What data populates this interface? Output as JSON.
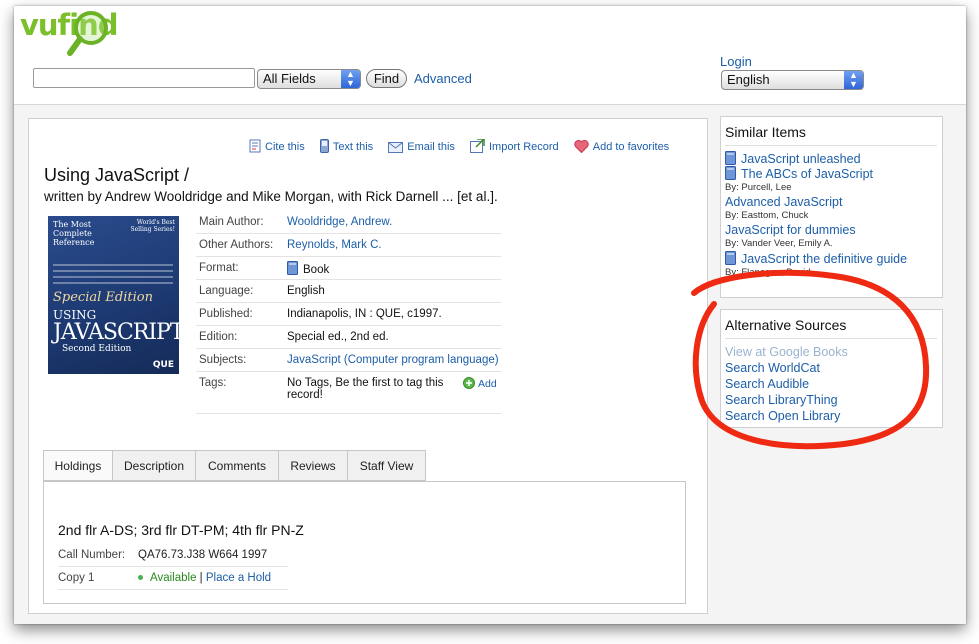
{
  "header": {
    "logo_text": "vufind",
    "search_value": "",
    "field_select": "All Fields",
    "find_label": "Find",
    "advanced_label": "Advanced",
    "login_label": "Login",
    "language_select": "English"
  },
  "toolbar": {
    "cite": "Cite this",
    "text": "Text this",
    "email": "Email this",
    "import": "Import Record",
    "favorite": "Add to favorites"
  },
  "record": {
    "title": "Using JavaScript /",
    "statement": "written by Andrew Wooldridge and Mike Morgan, with Rick Darnell ... [et al.].",
    "cover": {
      "line1": "The Most Complete Reference",
      "line2": "World's Best Selling Series!",
      "edition_script": "Special Edition",
      "using": "USING",
      "javascript": "JAVASCRIPT",
      "second": "Second Edition",
      "publisher": "QUE"
    },
    "fields": [
      {
        "label": "Main Author:",
        "value": "Wooldridge, Andrew.",
        "link": true
      },
      {
        "label": "Other Authors:",
        "value": "Reynolds, Mark C.",
        "link": true
      },
      {
        "label": "Format:",
        "value": "Book",
        "link": false
      },
      {
        "label": "Language:",
        "value": "English",
        "link": false
      },
      {
        "label": "Published:",
        "value": "Indianapolis, IN : QUE, c1997.",
        "link": false
      },
      {
        "label": "Edition:",
        "value": "Special ed., 2nd ed.",
        "link": false
      },
      {
        "label": "Subjects:",
        "value": "JavaScript (Computer program language)",
        "link": true
      },
      {
        "label": "Tags:",
        "value": "No Tags, Be the first to tag this record!",
        "link": false
      }
    ],
    "tags_add": "Add"
  },
  "tabs": [
    "Holdings",
    "Description",
    "Comments",
    "Reviews",
    "Staff View"
  ],
  "holdings": {
    "location": "2nd flr A-DS; 3rd flr DT-PM; 4th flr PN-Z",
    "call_number_label": "Call Number:",
    "call_number": "QA76.73.J38 W664 1997",
    "copy_label": "Copy 1",
    "status": "Available",
    "separator": "|",
    "hold_link": "Place a Hold"
  },
  "similar": {
    "title": "Similar Items",
    "items": [
      {
        "title": "JavaScript unleashed",
        "by": ""
      },
      {
        "title": "The ABCs of JavaScript",
        "by": "By: Purcell, Lee"
      },
      {
        "title": "Advanced JavaScript",
        "by": "By: Easttom, Chuck"
      },
      {
        "title": "JavaScript for dummies",
        "by": "By: Vander Veer, Emily A."
      },
      {
        "title": "JavaScript the definitive guide",
        "by": "By: Flanagan, David"
      }
    ]
  },
  "alternative": {
    "title": "Alternative Sources",
    "items": [
      "View at Google Books",
      "Search WorldCat",
      "Search Audible",
      "Search LibraryThing",
      "Search Open Library"
    ]
  },
  "colors": {
    "link": "#1d5ea8",
    "logo_green": "#7bbf2a",
    "annotation_red": "#ee2a12",
    "available_green": "#2b8a1d"
  }
}
